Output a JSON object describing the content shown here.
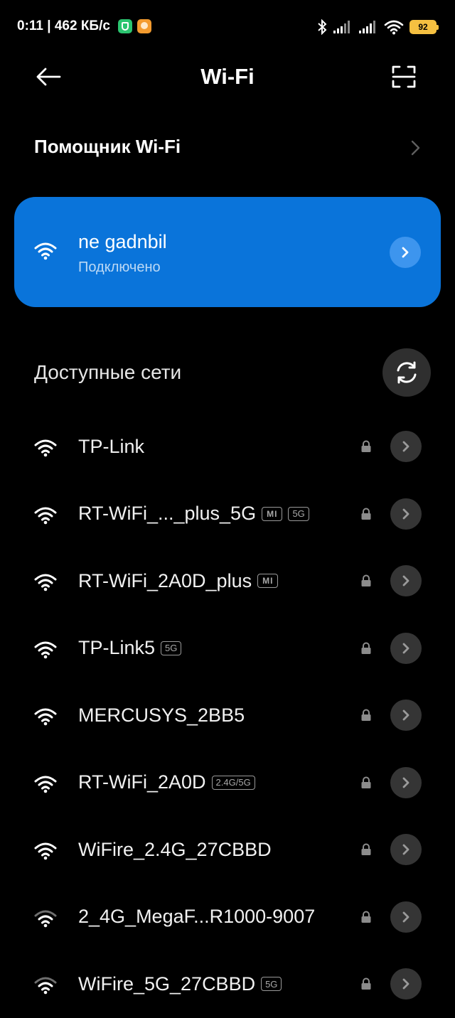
{
  "status_bar": {
    "time_speed": "0:11 | 462 КБ/с",
    "battery": "92",
    "icons": [
      "shield-app-icon",
      "app-icon",
      "bluetooth-icon",
      "signal-icon",
      "signal-icon",
      "wifi-icon",
      "battery-icon"
    ]
  },
  "header": {
    "title": "Wi-Fi",
    "back_icon": "arrow-left-icon",
    "scan_icon": "qr-scan-icon"
  },
  "assistant": {
    "label": "Помощник Wi-Fi",
    "icon": "chevron-right-icon"
  },
  "connected": {
    "ssid": "ne gadnbil",
    "status": "Подключено",
    "color": "#0a74da"
  },
  "available": {
    "title": "Доступные сети",
    "refresh_icon": "refresh-icon",
    "networks": [
      {
        "name": "TP-Link",
        "badges": [],
        "signal": "full"
      },
      {
        "name": "RT-WiFi_..._plus_5G",
        "badges": [
          "mi",
          "5G"
        ],
        "signal": "full"
      },
      {
        "name": "RT-WiFi_2A0D_plus",
        "badges": [
          "mi"
        ],
        "signal": "full"
      },
      {
        "name": "TP-Link5",
        "badges": [
          "5G"
        ],
        "signal": "full"
      },
      {
        "name": "MERCUSYS_2BB5",
        "badges": [],
        "signal": "full"
      },
      {
        "name": "RT-WiFi_2A0D",
        "badges": [
          "2.4G/5G"
        ],
        "signal": "full"
      },
      {
        "name": "WiFire_2.4G_27CBBD",
        "badges": [],
        "signal": "full"
      },
      {
        "name": "2_4G_MegaF...R1000-9007",
        "badges": [],
        "signal": "medium"
      },
      {
        "name": "WiFire_5G_27CBBD",
        "badges": [
          "5G"
        ],
        "signal": "medium"
      }
    ]
  }
}
